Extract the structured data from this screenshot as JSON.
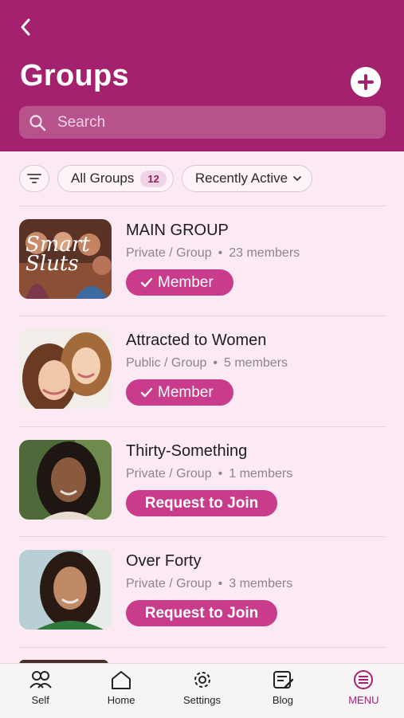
{
  "header": {
    "title": "Groups",
    "search_placeholder": "Search",
    "accent": "#a4226d"
  },
  "filters": {
    "all_label": "All Groups",
    "all_count": "12",
    "sort_label": "Recently Active"
  },
  "groups": [
    {
      "name": "MAIN GROUP",
      "type": "Private / Group",
      "members": "23 members",
      "action": "Member",
      "image_text": "Smart Sluts"
    },
    {
      "name": "Attracted to Women",
      "type": "Public / Group",
      "members": "5 members",
      "action": "Member"
    },
    {
      "name": "Thirty-Something",
      "type": "Private / Group",
      "members": "1 members",
      "action": "Request to Join"
    },
    {
      "name": "Over Forty",
      "type": "Private / Group",
      "members": "3 members",
      "action": "Request to Join"
    }
  ],
  "nav": {
    "self": "Self",
    "home": "Home",
    "settings": "Settings",
    "blog": "Blog",
    "menu": "MENU"
  },
  "icons": [
    "back-arrow-icon",
    "plus-icon",
    "search-icon",
    "filter-icon",
    "chevron-down-icon",
    "check-icon",
    "people-icon",
    "home-icon",
    "gear-icon",
    "blog-icon",
    "menu-icon"
  ]
}
